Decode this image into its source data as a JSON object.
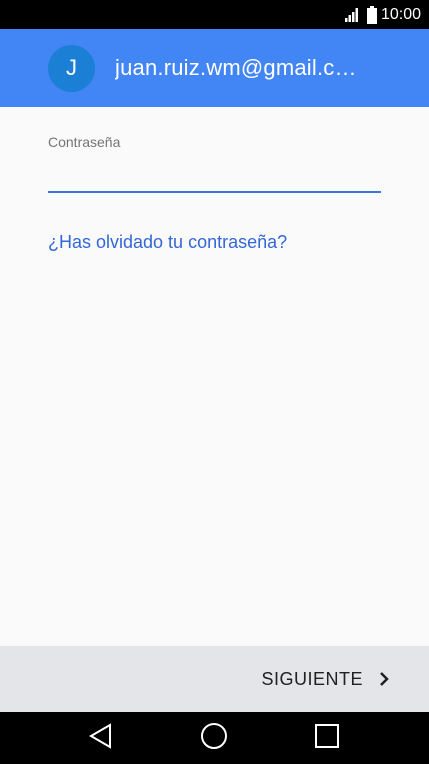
{
  "status_bar": {
    "time": "10:00",
    "icons": [
      "signal-icon",
      "battery-icon"
    ]
  },
  "header": {
    "avatar_initial": "J",
    "email": "juan.ruiz.wm@gmail.c…"
  },
  "form": {
    "password_label": "Contraseña",
    "password_value": "",
    "forgot_link": "¿Has olvidado tu contraseña?"
  },
  "footer": {
    "next_label": "SIGUIENTE",
    "next_icon": "chevron-right-icon"
  },
  "nav_bar": {
    "icons": [
      "back-icon",
      "home-icon",
      "recents-icon"
    ]
  },
  "colors": {
    "header_bg": "#4285f4",
    "avatar_bg": "#1a7fd5",
    "accent": "#3b78e7",
    "link": "#3367d6",
    "footer_bg": "#e3e5e8"
  }
}
